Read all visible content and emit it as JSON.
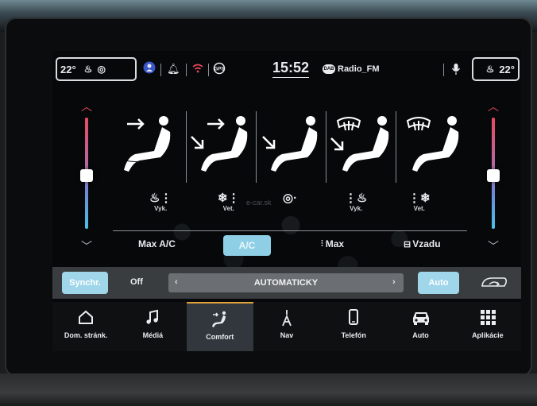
{
  "status_bar": {
    "temp_left": "22°",
    "temp_right": "22°",
    "time": "15:52",
    "radio_badge": "DAB",
    "radio_station": "Radio_FM",
    "icons": [
      "seat-heat-icon",
      "steering-heat-icon",
      "profile-icon",
      "bell-icon",
      "wifi-icon",
      "gps-icon",
      "microphone-icon"
    ]
  },
  "seat_modes": [
    {
      "name": "feet-air",
      "icon": "seat-airflow-icon"
    },
    {
      "name": "body-feet-air",
      "icon": "seat-airflow-icon"
    },
    {
      "name": "feet-only-air",
      "icon": "seat-airflow-icon"
    },
    {
      "name": "defrost-feet-air",
      "icon": "defrost-icon"
    },
    {
      "name": "defrost-air",
      "icon": "defrost-icon"
    }
  ],
  "seat_controls": {
    "left_heat": "Vyk.",
    "left_vent": "Vet.",
    "right_heat": "Vyk.",
    "right_vent": "Vet."
  },
  "ac_row": {
    "max_ac": "Max A/C",
    "ac": "A/C",
    "max_defrost": "Max",
    "rear": "Vzadu"
  },
  "fan_bar": {
    "synchr": "Synchr.",
    "off": "Off",
    "prev": "‹",
    "mode_value": "AUTOMATICKY",
    "next": "›",
    "auto": "Auto"
  },
  "nav": [
    {
      "label": "Dom. stránk.",
      "icon": "home-icon",
      "glyph": "⌂"
    },
    {
      "label": "Médiá",
      "icon": "music-note-icon",
      "glyph": "♫"
    },
    {
      "label": "Comfort",
      "icon": "seat-icon",
      "glyph": "⟋"
    },
    {
      "label": "Nav",
      "icon": "navigation-icon",
      "glyph": "⇡"
    },
    {
      "label": "Telefón",
      "icon": "phone-icon",
      "glyph": "▯"
    },
    {
      "label": "Auto",
      "icon": "car-icon",
      "glyph": "⛟"
    },
    {
      "label": "Aplikácie",
      "icon": "apps-grid-icon",
      "glyph": "⋮⋮⋮"
    }
  ],
  "watermark": "e-car.sk",
  "colors": {
    "accent_blue": "#9fd6ea",
    "active_tab_border": "#e2a23c",
    "hot": "#e94a5f",
    "cold": "#4bc1e8"
  },
  "sliders": {
    "left_level": 0.48,
    "right_level": 0.48
  }
}
